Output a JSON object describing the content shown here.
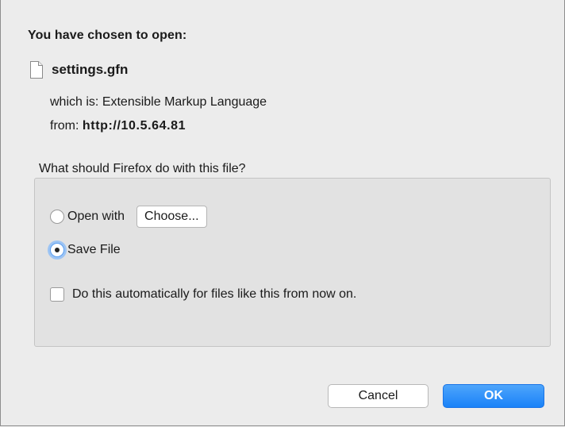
{
  "dialog": {
    "heading": "You have chosen to open:",
    "file_name": "settings.gfn",
    "type_label": "which is:",
    "type_value": "Extensible Markup Language",
    "from_label": "from:",
    "from_value": "http://10.5.64.81",
    "question": "What should Firefox do with this file?"
  },
  "options": {
    "open_with_label": "Open with",
    "choose_button": "Choose...",
    "save_file_label": "Save File",
    "save_file_selected": true,
    "open_with_selected": false,
    "auto_label": "Do this automatically for files like this from now on.",
    "auto_checked": false
  },
  "buttons": {
    "cancel": "Cancel",
    "ok": "OK"
  },
  "colors": {
    "accent": "#1a82f8",
    "focus_ring": "#9cc4f4",
    "background": "#ececec"
  },
  "icons": {
    "file": "document-icon"
  }
}
